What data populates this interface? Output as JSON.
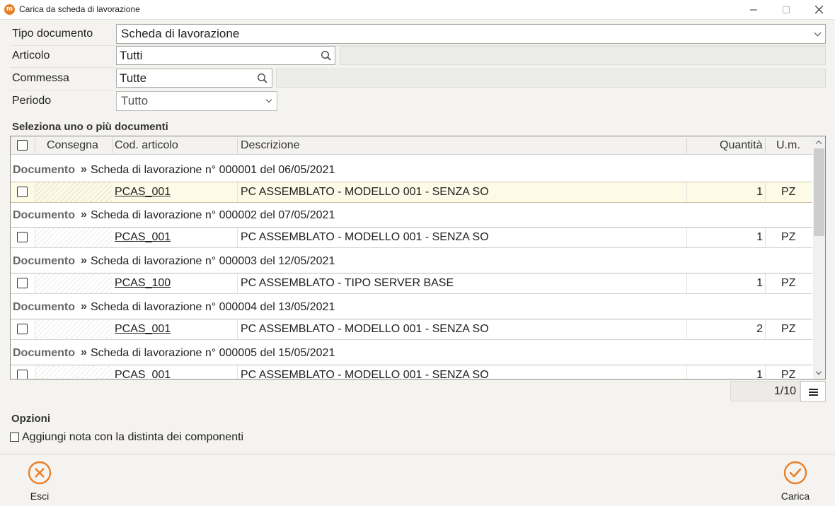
{
  "window": {
    "title": "Carica da scheda di lavorazione",
    "app_icon": "m",
    "controls": [
      "minimize-icon",
      "maximize-icon",
      "close-icon"
    ]
  },
  "form": {
    "tipo_documento": {
      "label": "Tipo documento",
      "value": "Scheda di lavorazione"
    },
    "articolo": {
      "label": "Articolo",
      "value": "Tutti"
    },
    "commessa": {
      "label": "Commessa",
      "value": "Tutte"
    },
    "periodo": {
      "label": "Periodo",
      "value": "Tutto"
    }
  },
  "documents_section": {
    "title": "Seleziona uno o più documenti"
  },
  "grid": {
    "columns": [
      "Consegna",
      "Cod. articolo",
      "Descrizione",
      "Quantità",
      "U.m."
    ],
    "doc_label": "Documento",
    "doc_separator": "»",
    "groups": [
      {
        "doc": "Scheda di lavorazione n° 000001 del 06/05/2021",
        "code": "PCAS_001",
        "desc": "PC ASSEMBLATO - MODELLO 001 - SENZA SO",
        "qty": "1",
        "um": "PZ"
      },
      {
        "doc": "Scheda di lavorazione n° 000002 del 07/05/2021",
        "code": "PCAS_001",
        "desc": "PC ASSEMBLATO - MODELLO 001 - SENZA SO",
        "qty": "1",
        "um": "PZ"
      },
      {
        "doc": "Scheda di lavorazione n° 000003 del 12/05/2021",
        "code": "PCAS_100",
        "desc": "PC ASSEMBLATO - TIPO SERVER BASE",
        "qty": "1",
        "um": "PZ"
      },
      {
        "doc": "Scheda di lavorazione n° 000004 del 13/05/2021",
        "code": "PCAS_001",
        "desc": "PC ASSEMBLATO - MODELLO 001 - SENZA SO",
        "qty": "2",
        "um": "PZ"
      },
      {
        "doc": "Scheda di lavorazione n° 000005 del 15/05/2021",
        "code": "PCAS_001",
        "desc": "PC ASSEMBLATO - MODELLO 001 - SENZA SO",
        "qty": "1",
        "um": "PZ"
      }
    ],
    "highlighted_row": 0
  },
  "pager": {
    "text": "1/10"
  },
  "options": {
    "title": "Opzioni",
    "add_note_label": "Aggiungi nota con la distinta dei componenti",
    "add_note_checked": false
  },
  "footer": {
    "esci_label": "Esci",
    "carica_label": "Carica",
    "accent_color": "#e8802a"
  }
}
